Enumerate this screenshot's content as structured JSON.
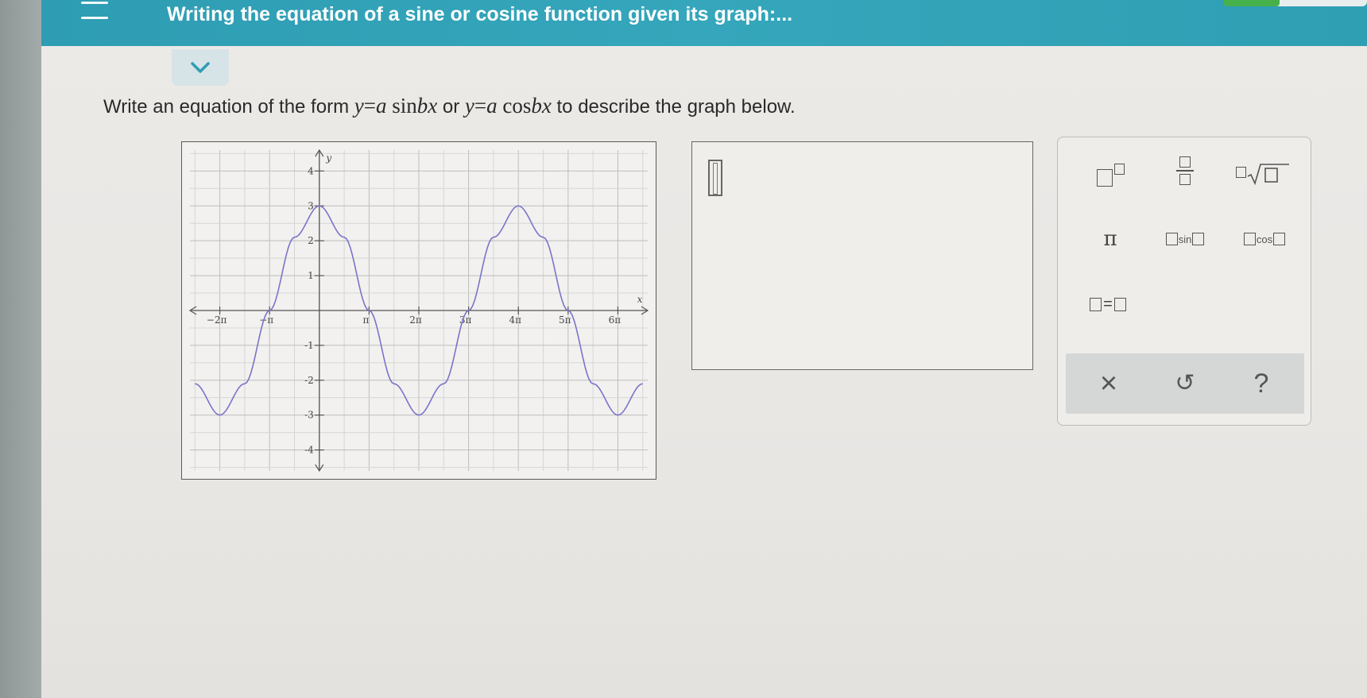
{
  "header": {
    "title": "Writing the equation of a sine or cosine function given its graph:..."
  },
  "question": {
    "prefix": "Write an equation of the form ",
    "eq1_y": "y",
    "eq1_eq": "=",
    "eq1_a": "a",
    "eq1_fn": " sin",
    "eq1_bx": "bx",
    "or": " or ",
    "eq2_y": "y",
    "eq2_eq": "=",
    "eq2_a": "a",
    "eq2_fn": " cos",
    "eq2_bx": "bx",
    "suffix": " to describe the graph below."
  },
  "graph": {
    "x_axis_label": "x",
    "y_axis_label": "y",
    "x_tick_labels": [
      "−2π",
      "−π",
      "π",
      "2π",
      "3π",
      "4π",
      "5π",
      "6π"
    ],
    "y_tick_labels_pos": [
      "4",
      "3",
      "2",
      "1"
    ],
    "y_tick_labels_neg": [
      "-1",
      "-2",
      "-3",
      "-4"
    ],
    "curve_color": "#7a74c9"
  },
  "chart_data": {
    "type": "line",
    "title": "",
    "xlabel": "x",
    "ylabel": "y",
    "x_unit": "π",
    "xlim": [
      -2.6,
      6.6
    ],
    "ylim": [
      -4.6,
      4.6
    ],
    "x_ticks": [
      -2,
      -1,
      1,
      2,
      3,
      4,
      5,
      6
    ],
    "y_ticks": [
      -4,
      -3,
      -2,
      -1,
      1,
      2,
      3,
      4
    ],
    "grid": true,
    "series": [
      {
        "x": [
          -2.5,
          -2,
          -1.5,
          -1,
          -0.5,
          0,
          0.5,
          1,
          1.5,
          2,
          2.5,
          3,
          3.5,
          4,
          4.5,
          5,
          5.5,
          6,
          6.5
        ],
        "y": [
          -2.1,
          -3,
          -2.1,
          0,
          2.1,
          3,
          2.1,
          0,
          -2.1,
          -3,
          -2.1,
          0,
          2.1,
          3,
          2.1,
          0,
          -2.1,
          -3,
          -2.1
        ]
      }
    ]
  },
  "palette": {
    "pi_label": "π",
    "sin_label": "sin",
    "cos_label": "cos",
    "equals_label": "=",
    "clear_label": "×",
    "undo_label": "↺",
    "help_label": "?"
  }
}
